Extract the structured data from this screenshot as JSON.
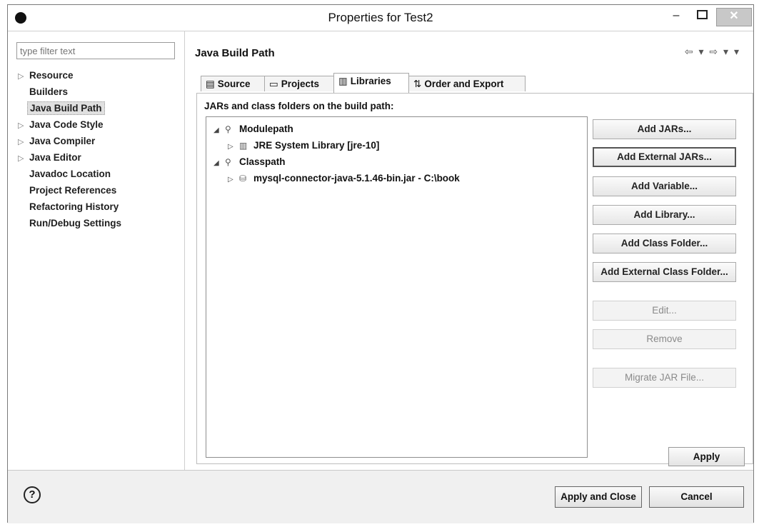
{
  "window": {
    "title": "Properties for Test2",
    "min_glyph": "–",
    "close_glyph": "✕"
  },
  "filter": {
    "placeholder": "type filter text"
  },
  "nav_tree": [
    {
      "label": "Resource",
      "expandable": true
    },
    {
      "label": "Builders",
      "expandable": false
    },
    {
      "label": "Java Build Path",
      "expandable": false,
      "selected": true
    },
    {
      "label": "Java Code Style",
      "expandable": true
    },
    {
      "label": "Java Compiler",
      "expandable": true
    },
    {
      "label": "Java Editor",
      "expandable": true
    },
    {
      "label": "Javadoc Location",
      "expandable": false
    },
    {
      "label": "Project References",
      "expandable": false
    },
    {
      "label": "Refactoring History",
      "expandable": false
    },
    {
      "label": "Run/Debug Settings",
      "expandable": false
    }
  ],
  "page": {
    "title": "Java Build Path",
    "nav_arrows": "⇦ ▾ ⇨ ▾ ▾"
  },
  "tabs": [
    {
      "label": "Source",
      "icon": "source-folder-icon",
      "glyph": "▤"
    },
    {
      "label": "Projects",
      "icon": "projects-icon",
      "glyph": "▭"
    },
    {
      "label": "Libraries",
      "icon": "libraries-icon",
      "glyph": "▥",
      "active": true
    },
    {
      "label": "Order and Export",
      "icon": "order-export-icon",
      "glyph": "⇅"
    }
  ],
  "panel": {
    "label": "JARs and class folders on the build path:",
    "entries": [
      {
        "twisty": "◢",
        "icon": "modulepath-icon",
        "glyph": "⚲",
        "label": "Modulepath"
      },
      {
        "twisty": "▷",
        "icon": "library-icon",
        "glyph": "▥",
        "label": "JRE System Library [jre-10]"
      },
      {
        "twisty": "◢",
        "icon": "classpath-icon",
        "glyph": "⚲",
        "label": "Classpath"
      },
      {
        "twisty": "▷",
        "icon": "jar-icon",
        "glyph": "⛁",
        "label": "mysql-connector-java-5.1.46-bin.jar - C:\\book"
      }
    ]
  },
  "buttons": {
    "add_jars": "Add JARs...",
    "add_external_jars": "Add External JARs...",
    "add_variable": "Add Variable...",
    "add_library": "Add Library...",
    "add_class_folder": "Add Class Folder...",
    "add_external_class_folder": "Add External Class Folder...",
    "edit": "Edit...",
    "remove": "Remove",
    "migrate_jar": "Migrate JAR File..."
  },
  "apply": "Apply",
  "footer": {
    "help": "?",
    "apply_and_close": "Apply and Close",
    "cancel": "Cancel"
  }
}
